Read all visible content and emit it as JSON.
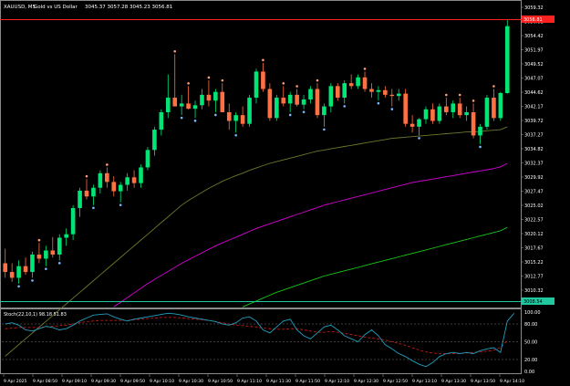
{
  "header": {
    "symbol": "XAUUSD, M5",
    "description": "Gold vs US Dollar",
    "ohlc": "3045.37 3057.28 3045.23 3056.81"
  },
  "price_axis": {
    "labels": [
      "3059.32",
      "3056.81",
      "3054.42",
      "3051.97",
      "3049.52",
      "3047.07",
      "3044.62",
      "3042.17",
      "3039.72",
      "3037.27",
      "3034.82",
      "3032.37",
      "3029.92",
      "3027.47",
      "3025.02",
      "3022.57",
      "3020.12",
      "3017.67",
      "3015.22",
      "3012.77",
      "3010.32"
    ],
    "current_price": "3056.81",
    "lower_tag": "3008.54"
  },
  "stoch": {
    "label": "Stoch(22,10,1) 98.18 51.83",
    "levels": [
      "100.00",
      "80.00",
      "50.00",
      "20.00",
      "0.00"
    ]
  },
  "time_axis": {
    "labels": [
      "9 Apr 2025",
      "9 Apr 08:50",
      "9 Apr 09:10",
      "9 Apr 09:30",
      "9 Apr 09:50",
      "9 Apr 10:10",
      "9 Apr 10:30",
      "9 Apr 10:50",
      "9 Apr 11:10",
      "9 Apr 11:30",
      "9 Apr 11:50",
      "9 Apr 12:10",
      "9 Apr 12:30",
      "9 Apr 12:50",
      "9 Apr 13:10",
      "9 Apr 13:30",
      "9 Apr 13:50",
      "9 Apr 14:10"
    ]
  },
  "colors": {
    "bull": "#00e676",
    "bear": "#ff7043",
    "ma_fast": "#6b7a2a",
    "ma_mid": "#d400d4",
    "ma_slow": "#17c817",
    "stoch_main": "#1f9fbf",
    "stoch_signal": "#d81b1b",
    "grid": "#3a3a3a",
    "price_line": "#ff2020"
  },
  "chart_data": {
    "type": "candlestick",
    "price_range": [
      3008.54,
      3061.0
    ],
    "candles": [
      [
        3016.0,
        3018.5,
        3013.5,
        3014.5
      ],
      [
        3014.5,
        3016.0,
        3012.8,
        3013.5
      ],
      [
        3013.5,
        3016.5,
        3012.5,
        3015.5
      ],
      [
        3015.5,
        3017.0,
        3014.0,
        3014.5
      ],
      [
        3014.5,
        3018.0,
        3013.5,
        3017.5
      ],
      [
        3017.5,
        3019.5,
        3016.0,
        3016.8
      ],
      [
        3016.8,
        3019.0,
        3015.5,
        3018.2
      ],
      [
        3018.2,
        3020.5,
        3017.0,
        3017.5
      ],
      [
        3017.5,
        3021.0,
        3016.5,
        3020.4
      ],
      [
        3020.4,
        3022.0,
        3019.0,
        3021.0
      ],
      [
        3021.0,
        3026.0,
        3020.0,
        3025.5
      ],
      [
        3025.5,
        3029.0,
        3024.0,
        3028.5
      ],
      [
        3028.5,
        3030.5,
        3027.0,
        3027.5
      ],
      [
        3027.5,
        3029.5,
        3026.0,
        3029.0
      ],
      [
        3029.0,
        3032.0,
        3028.0,
        3031.5
      ],
      [
        3031.5,
        3032.5,
        3029.0,
        3030.0
      ],
      [
        3030.0,
        3031.0,
        3027.5,
        3028.4
      ],
      [
        3028.4,
        3030.0,
        3026.5,
        3029.5
      ],
      [
        3029.5,
        3031.5,
        3028.5,
        3030.8
      ],
      [
        3030.8,
        3032.0,
        3029.0,
        3029.8
      ],
      [
        3029.8,
        3033.0,
        3029.0,
        3032.5
      ],
      [
        3032.5,
        3036.0,
        3032.0,
        3035.5
      ],
      [
        3035.5,
        3039.5,
        3034.5,
        3039.0
      ],
      [
        3039.0,
        3042.5,
        3038.0,
        3042.0
      ],
      [
        3042.0,
        3048.5,
        3041.0,
        3044.5
      ],
      [
        3044.5,
        3052.0,
        3043.5,
        3043.0
      ],
      [
        3043.0,
        3045.0,
        3041.5,
        3043.5
      ],
      [
        3043.5,
        3046.5,
        3042.5,
        3042.6
      ],
      [
        3042.6,
        3044.0,
        3041.0,
        3043.2
      ],
      [
        3043.2,
        3046.0,
        3042.5,
        3045.0
      ],
      [
        3045.0,
        3047.5,
        3043.0,
        3044.0
      ],
      [
        3044.0,
        3046.0,
        3042.0,
        3045.5
      ],
      [
        3045.5,
        3047.0,
        3043.0,
        3042.0
      ],
      [
        3042.0,
        3043.5,
        3039.0,
        3040.5
      ],
      [
        3040.5,
        3042.0,
        3038.5,
        3041.5
      ],
      [
        3041.5,
        3043.0,
        3039.5,
        3040.0
      ],
      [
        3040.0,
        3045.0,
        3039.5,
        3044.5
      ],
      [
        3044.5,
        3049.5,
        3043.5,
        3049.0
      ],
      [
        3049.0,
        3050.5,
        3045.5,
        3046.0
      ],
      [
        3046.0,
        3047.0,
        3040.5,
        3041.0
      ],
      [
        3041.0,
        3045.0,
        3040.5,
        3044.5
      ],
      [
        3044.5,
        3046.5,
        3043.0,
        3043.5
      ],
      [
        3043.5,
        3045.5,
        3042.0,
        3045.0
      ],
      [
        3045.0,
        3046.0,
        3043.0,
        3043.3
      ],
      [
        3043.3,
        3045.0,
        3042.5,
        3044.2
      ],
      [
        3044.2,
        3046.5,
        3043.5,
        3046.0
      ],
      [
        3046.0,
        3047.0,
        3041.0,
        3041.5
      ],
      [
        3041.5,
        3043.5,
        3039.5,
        3043.0
      ],
      [
        3043.0,
        3047.0,
        3042.0,
        3046.5
      ],
      [
        3046.5,
        3047.0,
        3044.0,
        3044.5
      ],
      [
        3044.5,
        3047.5,
        3043.5,
        3047.0
      ],
      [
        3047.0,
        3048.5,
        3046.0,
        3046.5
      ],
      [
        3046.5,
        3048.5,
        3046.0,
        3048.0
      ],
      [
        3048.0,
        3049.0,
        3045.5,
        3046.0
      ],
      [
        3046.0,
        3047.0,
        3044.5,
        3045.5
      ],
      [
        3045.5,
        3046.5,
        3044.0,
        3045.8
      ],
      [
        3045.8,
        3046.5,
        3044.5,
        3045.0
      ],
      [
        3045.0,
        3046.0,
        3043.0,
        3044.8
      ],
      [
        3044.8,
        3046.0,
        3044.0,
        3045.2
      ],
      [
        3045.2,
        3046.0,
        3039.5,
        3040.0
      ],
      [
        3040.0,
        3041.5,
        3038.5,
        3039.5
      ],
      [
        3039.5,
        3041.0,
        3038.0,
        3040.8
      ],
      [
        3040.8,
        3043.0,
        3040.0,
        3042.5
      ],
      [
        3042.5,
        3043.5,
        3040.0,
        3040.5
      ],
      [
        3040.5,
        3043.5,
        3040.0,
        3043.0
      ],
      [
        3043.0,
        3044.5,
        3041.5,
        3042.0
      ],
      [
        3042.0,
        3044.0,
        3041.0,
        3043.5
      ],
      [
        3043.5,
        3044.5,
        3041.0,
        3041.5
      ],
      [
        3041.5,
        3043.0,
        3040.5,
        3042.0
      ],
      [
        3042.0,
        3043.5,
        3037.5,
        3038.0
      ],
      [
        3038.0,
        3040.0,
        3036.5,
        3039.5
      ],
      [
        3039.5,
        3045.0,
        3039.0,
        3044.5
      ],
      [
        3044.5,
        3046.0,
        3040.5,
        3041.0
      ],
      [
        3041.0,
        3045.5,
        3040.5,
        3045.3
      ],
      [
        3045.3,
        3058.0,
        3045.2,
        3056.81
      ]
    ],
    "ma_fast": [
      3000,
      3001,
      3002,
      3003,
      3004,
      3005,
      3006,
      3007,
      3008,
      3009,
      3010,
      3011,
      3012,
      3013,
      3014,
      3015,
      3016,
      3017,
      3018,
      3019,
      3020,
      3021,
      3022,
      3023,
      3024,
      3025,
      3026,
      3026.8,
      3027.5,
      3028.2,
      3028.9,
      3029.5,
      3030.1,
      3030.6,
      3031.1,
      3031.5,
      3032,
      3032.4,
      3032.8,
      3033.2,
      3033.5,
      3033.8,
      3034.1,
      3034.4,
      3034.7,
      3035,
      3035.3,
      3035.5,
      3035.7,
      3035.9,
      3036.1,
      3036.3,
      3036.5,
      3036.7,
      3036.9,
      3037.1,
      3037.3,
      3037.5,
      3037.6,
      3037.7,
      3037.8,
      3037.9,
      3038,
      3038.1,
      3038.2,
      3038.3,
      3038.4,
      3038.5,
      3038.6,
      3038.6,
      3038.7,
      3038.8,
      3038.9,
      3039,
      3039.5
    ],
    "ma_mid_start_index": 16,
    "ma_mid": [
      3008.5,
      3009.3,
      3010.1,
      3010.9,
      3011.7,
      3012.5,
      3013.2,
      3013.9,
      3014.6,
      3015.3,
      3016,
      3016.6,
      3017.2,
      3017.8,
      3018.4,
      3019,
      3019.5,
      3020,
      3020.5,
      3021,
      3021.5,
      3022,
      3022.4,
      3022.8,
      3023.2,
      3023.6,
      3024,
      3024.4,
      3024.8,
      3025.2,
      3025.6,
      3026,
      3026.3,
      3026.6,
      3026.9,
      3027.2,
      3027.5,
      3027.8,
      3028.1,
      3028.4,
      3028.7,
      3029,
      3029.3,
      3029.6,
      3029.9,
      3030.1,
      3030.3,
      3030.5,
      3030.7,
      3030.9,
      3031.1,
      3031.3,
      3031.5,
      3031.7,
      3031.9,
      3032.1,
      3032.3,
      3032.6,
      3033.2
    ],
    "ma_slow_start_index": 35,
    "ma_slow": [
      3008.5,
      3009.0,
      3009.5,
      3010.0,
      3010.5,
      3011.0,
      3011.4,
      3011.8,
      3012.2,
      3012.6,
      3013.0,
      3013.4,
      3013.8,
      3014.1,
      3014.4,
      3014.7,
      3015.0,
      3015.3,
      3015.6,
      3015.9,
      3016.2,
      3016.5,
      3016.8,
      3017.1,
      3017.4,
      3017.7,
      3018.0,
      3018.3,
      3018.6,
      3018.9,
      3019.2,
      3019.5,
      3019.8,
      3020.1,
      3020.4,
      3020.7,
      3021.0,
      3021.3,
      3021.6,
      3022.2
    ],
    "stoch_main": [
      80,
      82,
      78,
      70,
      68,
      72,
      76,
      74,
      70,
      72,
      78,
      85,
      90,
      95,
      96,
      97,
      92,
      88,
      85,
      88,
      90,
      92,
      94,
      96,
      98,
      97,
      95,
      92,
      90,
      88,
      86,
      84,
      80,
      78,
      82,
      90,
      92,
      85,
      70,
      65,
      75,
      85,
      88,
      70,
      60,
      55,
      65,
      75,
      78,
      70,
      60,
      55,
      50,
      62,
      70,
      60,
      45,
      38,
      30,
      25,
      18,
      12,
      8,
      15,
      25,
      30,
      32,
      30,
      32,
      30,
      35,
      38,
      40,
      32,
      85,
      98
    ],
    "stoch_signal": [
      72,
      73,
      74,
      74,
      74,
      74,
      75,
      76,
      77,
      78,
      80,
      82,
      84,
      85,
      86,
      86,
      86,
      86,
      86,
      87,
      88,
      89,
      90,
      91,
      91,
      91,
      90,
      89,
      88,
      87,
      86,
      84,
      82,
      80,
      78,
      77,
      76,
      75,
      73,
      72,
      71,
      71,
      72,
      72,
      70,
      68,
      66,
      66,
      67,
      66,
      64,
      62,
      60,
      58,
      56,
      55,
      53,
      50,
      47,
      44,
      40,
      36,
      33,
      31,
      30,
      30,
      30,
      30,
      31,
      32,
      33,
      34,
      36,
      40,
      51.83
    ]
  }
}
